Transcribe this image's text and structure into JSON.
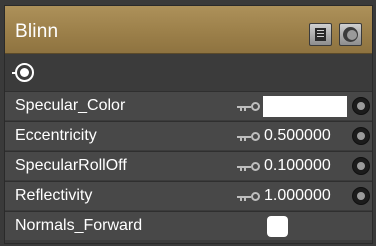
{
  "panel": {
    "title": "Blinn",
    "header_icons": [
      "document-icon",
      "sphere-icon"
    ],
    "accent_color": "#a38752"
  },
  "toolbar": {
    "icon": "target-icon"
  },
  "properties": [
    {
      "label": "Specular_Color",
      "type": "color",
      "value": "",
      "swatch_color": "#ffffff"
    },
    {
      "label": "Eccentricity",
      "type": "number",
      "value": "0.500000"
    },
    {
      "label": "SpecularRollOff",
      "type": "number",
      "value": "0.100000"
    },
    {
      "label": "Reflectivity",
      "type": "number",
      "value": "1.000000"
    },
    {
      "label": "Normals_Forward",
      "type": "checkbox",
      "value": "",
      "checked": false
    }
  ]
}
